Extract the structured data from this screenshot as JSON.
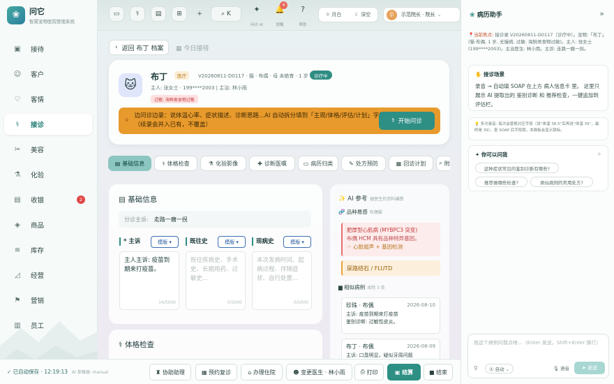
{
  "app": {
    "title": "问它",
    "subtitle": "智慧宠物医院管理系统",
    "logo_icon": "paw-icon"
  },
  "sidebar": {
    "items": [
      {
        "label": "接待",
        "icon": "reception-icon",
        "glyph": "▣",
        "active": false
      },
      {
        "label": "客户",
        "icon": "customers-icon",
        "glyph": "☺",
        "active": false
      },
      {
        "label": "客情",
        "icon": "heart-icon",
        "glyph": "♡",
        "active": false
      },
      {
        "label": "接诊",
        "icon": "stethoscope-icon",
        "glyph": "⚕",
        "active": true
      },
      {
        "label": "美容",
        "icon": "scissors-icon",
        "glyph": "✂",
        "active": false
      },
      {
        "label": "化验",
        "icon": "flask-icon",
        "glyph": "⚗",
        "active": false
      },
      {
        "label": "收银",
        "icon": "cashier-icon",
        "glyph": "▤",
        "active": false,
        "badge": "2"
      },
      {
        "label": "商品",
        "icon": "box-icon",
        "glyph": "◈",
        "active": false
      },
      {
        "label": "库存",
        "icon": "stack-icon",
        "glyph": "≋",
        "active": false
      },
      {
        "label": "经营",
        "icon": "chart-icon",
        "glyph": "◿",
        "active": false
      },
      {
        "label": "营销",
        "icon": "flag-icon",
        "glyph": "⚑",
        "active": false
      },
      {
        "label": "员工",
        "icon": "staff-icon",
        "glyph": "▥",
        "active": false
      }
    ]
  },
  "topbar": {
    "search_label": "K",
    "items": [
      {
        "name": "问诊 AI",
        "glyph": "✦"
      },
      {
        "name": "提醒",
        "glyph": "🔔",
        "badge": "4"
      },
      {
        "name": "帮助",
        "glyph": "?"
      }
    ],
    "theme_light": "☼ 月白",
    "theme_dark": "☾ 深空",
    "user_avatar": "示",
    "user_name": "示范院长 · 院长"
  },
  "main": {
    "back_label": "返回 布丁 档案",
    "today_label": "今日接待",
    "patient": {
      "name": "布丁",
      "tag_medical": "医疗",
      "meta": "V20260811-D0117 · 猫 · 布偶 · 母 未绝育 · 1 岁",
      "status": "诊疗中",
      "owner": "主人: 张女士 · 199****2003  |  主治: 林小雨",
      "allergy": "过敏: 海鲜类食物过敏",
      "banner_text": "边问诊边录：说体温心率、症状描述、诊断思路...AI 自动拆分填到「主观/体格/评估/计划」字段（续录会并入已有，不覆盖）",
      "banner_button": "开始问诊"
    },
    "tabs": [
      "基础信息",
      "体格检查",
      "化验影像",
      "诊断医嘱",
      "病历归类",
      "处方预防",
      "回访计划",
      "附"
    ],
    "basic": {
      "title": "基础信息",
      "cc_label": "分诊主诉:",
      "cc_value": "走路一瘸一拐",
      "fields": [
        {
          "label": "* 主诉",
          "template": "模版 ▾",
          "value": "主人主诉: 疫苗到期来打疫苗。",
          "placeholder": "",
          "count": "14/5000"
        },
        {
          "label": "既往史",
          "template": "模版 ▾",
          "value": "",
          "placeholder": "既往疾病史、手术史、长期用药、过敏史...",
          "count": "0/5000"
        },
        {
          "label": "现病史",
          "template": "模版 ▾",
          "value": "",
          "placeholder": "本次发病时间、起病过程、伴随症状、自行处置...",
          "count": "0/5000"
        }
      ]
    },
    "exam": {
      "title": "体格检查"
    },
    "ai_ref": {
      "title": "AI 参考",
      "title_note": "据医生的资料编撰",
      "breed_title": "品种易感",
      "breed_note": "布偶猫",
      "alert": {
        "title": "肥厚型心肌病 (MYBPC3 突变)",
        "desc": "布偶 HCM 具有品种特异基因。",
        "hint": "☞ 心脏超声 + 基因检测"
      },
      "warn": "尿路结石 / FLUTD",
      "similar_title": "相似病例",
      "similar_note": "本院 3 条",
      "cases": [
        {
          "name": "珍珠 · 布偶",
          "date": "2026-08-10",
          "cc": "主诉: 疫苗到期来打疫苗",
          "dx": "鉴别诊断: 过敏性皮炎。"
        },
        {
          "name": "布丁 · 布偶",
          "date": "2026-08-09",
          "cc": "主诉: 口臭明显，疑似牙周问题",
          "dx": ""
        }
      ]
    }
  },
  "bottombar": {
    "autosave": "✓ 已自动保存 · 12:19:13",
    "source": "AI 草稿源: manual",
    "buttons": [
      "协助助理",
      "预约复诊",
      "办理住院",
      "变更医生 · 林小雨",
      "打印",
      "结算",
      "结束"
    ]
  },
  "right_panel": {
    "title": "病历助手",
    "focus_label": "当前焦点:",
    "focus_text": "接诊录 V20260811-D0117（诊疗中）。宠物:「布丁」(猫·布偶, 1 岁, 无慢病, 过敏: 海鲜类食物过敏)。主人: 张女士 (199****2003)。主治医生: 林小雨。主诉: 走路一瘸一拐。",
    "scene_title": "接诊场景",
    "scene_body": "录音 → 自动填 SOAP 在上方 病人信息卡 里。 这里只展示 AI 提取出的 鉴别诊断 和 推荐检查，一键追加到评估栏。",
    "tip": "多次录音: 每次会替换对应字段（说“体温 38.5”后再说“体温 39”，最终是 39）。复 SOAP 后字段锁，本面板会显示锁标。",
    "ask_title": "你可以问我",
    "chips": [
      "这种症状常见的鉴别诊断有哪些?",
      "推荐做哪些检查?",
      "类似病例的常用处方?"
    ],
    "input_placeholder": "就这个病例问我点啥...（Enter 发送，Shift+Enter 换行）",
    "mode": "Ⓐ 自动 ⌄",
    "voice": "语音",
    "send": "发送"
  }
}
